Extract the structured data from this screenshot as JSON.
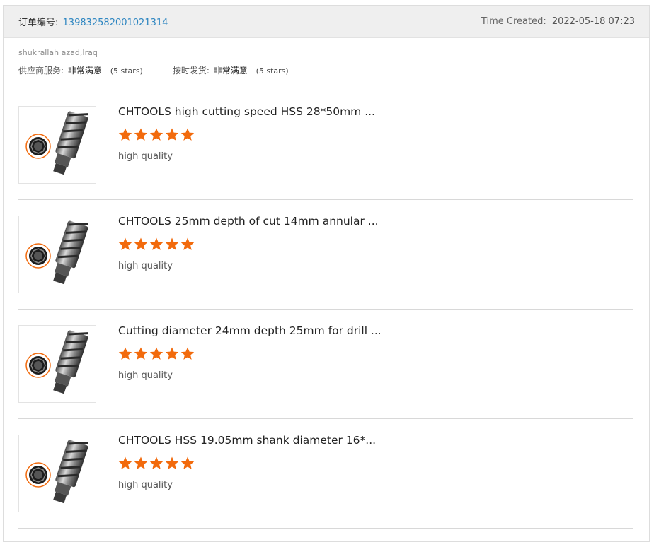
{
  "order": {
    "id_label": "订单编号:",
    "id_value": "139832582001021314",
    "time_label": "Time Created:",
    "time_value": "2022-05-18 07:23"
  },
  "buyer": {
    "name": "shukrallah azad,Iraq"
  },
  "ratings": [
    {
      "label": "供应商服务:",
      "value": "非常满意",
      "stars_text": "(5 stars)"
    },
    {
      "label": "按时发货:",
      "value": "非常满意",
      "stars_text": "(5 stars)"
    }
  ],
  "colors": {
    "star": "#f26a0c",
    "order_id": "#2e86c1",
    "header_bg": "#efefef"
  },
  "products": [
    {
      "title": "CHTOOLS high cutting speed HSS 28*50mm ...",
      "rating": 5,
      "rating_max": 5,
      "review": "high quality",
      "image_icon": "annular-cutter-image"
    },
    {
      "title": "CHTOOLS 25mm depth of cut 14mm annular ...",
      "rating": 5,
      "rating_max": 5,
      "review": "high quality",
      "image_icon": "annular-cutter-image"
    },
    {
      "title": "Cutting diameter 24mm depth 25mm for drill ...",
      "rating": 5,
      "rating_max": 5,
      "review": "high quality",
      "image_icon": "annular-cutter-image"
    },
    {
      "title": "CHTOOLS HSS 19.05mm shank diameter 16*...",
      "rating": 5,
      "rating_max": 5,
      "review": "high quality",
      "image_icon": "annular-cutter-image"
    }
  ]
}
